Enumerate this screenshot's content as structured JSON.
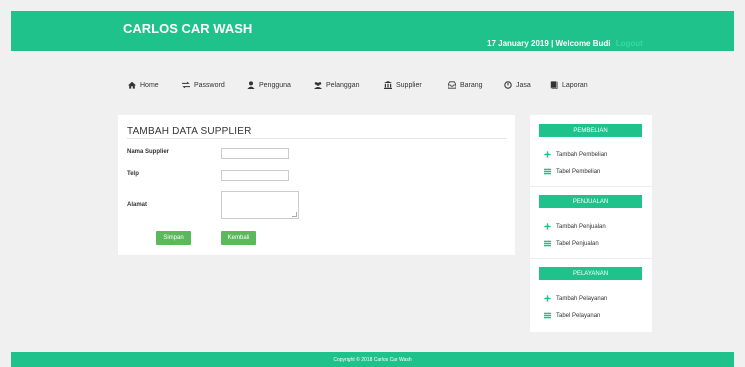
{
  "header": {
    "brand": "CARLOS CAR WASH",
    "date": "17 January 2019",
    "welcome": "| Welcome Budi",
    "logout": "Logout"
  },
  "nav": {
    "home": "Home",
    "password": "Password",
    "pengguna": "Pengguna",
    "pelanggan": "Pelanggan",
    "supplier": "Supplier",
    "barang": "Barang",
    "jasa": "Jasa",
    "laporan": "Laporan"
  },
  "form": {
    "title": "TAMBAH DATA SUPPLIER",
    "nama_label": "Nama Supplier",
    "nama_value": "",
    "telp_label": "Telp",
    "telp_value": "",
    "alamat_label": "Alamat",
    "alamat_value": "",
    "simpan": "Simpan",
    "kembali": "Kembali"
  },
  "sidebar": {
    "pembelian": {
      "header": "PEMBELIAN",
      "add": "Tambah Pembelian",
      "table": "Tabel Pembelian"
    },
    "penjualan": {
      "header": "PENJUALAN",
      "add": "Tambah Penjualan",
      "table": "Tabel Penjualan"
    },
    "pelayanan": {
      "header": "PELAYANAN",
      "add": "Tambah Pelayanan",
      "table": "Tabel Pelayanan"
    }
  },
  "footer": {
    "text": "Copyright © 2018 Carlos Car Wash"
  },
  "colors": {
    "accent": "#1ec28a",
    "button": "#5cb85c",
    "logout": "#33dba2"
  },
  "icons": {
    "home": "home-icon",
    "password": "exchange-icon",
    "pengguna": "user-icon",
    "pelanggan": "users-icon",
    "supplier": "bank-icon",
    "barang": "inbox-icon",
    "jasa": "power-icon",
    "laporan": "book-icon",
    "add": "plus-icon",
    "table": "list-icon"
  }
}
